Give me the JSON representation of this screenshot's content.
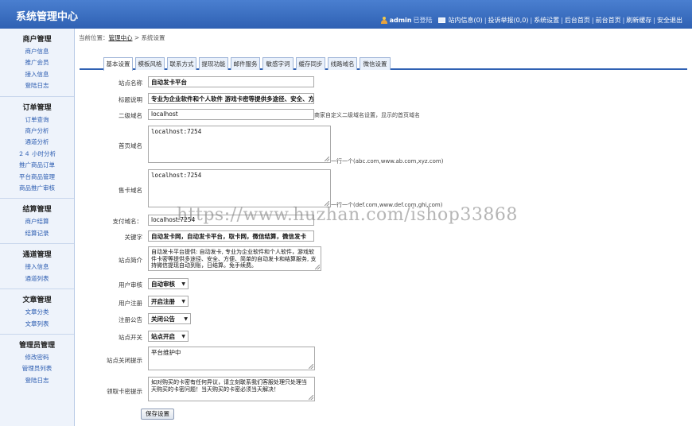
{
  "header": {
    "title": "系统管理中心",
    "user": "admin",
    "login_status": "已登陆",
    "messages": "站内信息(0)",
    "complaints": "投诉举报(0,0)",
    "nav": [
      "系统设置",
      "后台首页",
      "前台首页",
      "刷新缓存",
      "安全退出"
    ]
  },
  "sidebar": [
    {
      "title": "商户管理",
      "items": [
        "商户信息",
        "推广会员",
        "接入信息",
        "登陆日志"
      ]
    },
    {
      "title": "订单管理",
      "items": [
        "订单查询",
        "商户分析",
        "通道分析",
        "２４ 小时分析",
        "推广商品订单",
        "平台商品管理",
        "商品推广审核"
      ]
    },
    {
      "title": "结算管理",
      "items": [
        "商户结算",
        "结算记录"
      ]
    },
    {
      "title": "通道管理",
      "items": [
        "接入信息",
        "通道列表"
      ]
    },
    {
      "title": "文章管理",
      "items": [
        "文章分类",
        "文章列表"
      ]
    },
    {
      "title": "管理员管理",
      "items": [
        "修改密码",
        "管理员列表",
        "登陆日志"
      ]
    }
  ],
  "breadcrumb": {
    "prefix": "当前位置：",
    "link": "管理中心",
    "sep": " > ",
    "current": "系统设置"
  },
  "tabs": [
    "基本设置",
    "模板风格",
    "联系方式",
    "提现功能",
    "邮件服务",
    "敏感字词",
    "缓存同步",
    "线路域名",
    "微信设置"
  ],
  "form": {
    "site_name": {
      "label": "站点名称",
      "value": "自动发卡平台"
    },
    "title_desc": {
      "label": "标题说明",
      "value": "专业为企业软件和个人软件 游戏卡密等提供多途径、安全、方"
    },
    "second_domain": {
      "label": "二级域名",
      "value": "localhost",
      "hint": "商家自定义二级域名设置，显示的首页域名"
    },
    "home_domain": {
      "label": "首页域名",
      "value": "localhost:7254",
      "hint": "一行一个(abc.com,www.ab.com,xyz.com)"
    },
    "card_domain": {
      "label": "售卡域名",
      "value": "localhost:7254",
      "hint": "一行一个(def.com,www.def.com,ghi.com)"
    },
    "pay_domain": {
      "label": "支付域名：",
      "value": "localhost:7254"
    },
    "keywords": {
      "label": "关键字",
      "value": "自动发卡网，自动发卡平台，取卡网，微信结算，微信发卡"
    },
    "site_intro": {
      "label": "站点简介",
      "value": "自动发卡平台提供: 自动发卡, 专业为企业软件和个人软件，游戏软件卡密等提供多途径、安全、方便、简单的自动发卡和结算服务, 支持微信提现自动到账，日结算。免手续费。"
    },
    "user_review": {
      "label": "用户审核",
      "value": "自动审核"
    },
    "user_register": {
      "label": "用户注册",
      "value": "开启注册"
    },
    "register_notice": {
      "label": "注册公告",
      "value": "关闭公告"
    },
    "site_switch": {
      "label": "站点开关",
      "value": "站点开启"
    },
    "site_closed_tip": {
      "label": "站点关闭提示",
      "value": "平台维护中"
    },
    "card_tip": {
      "label": "领取卡密提示",
      "value": "如对购买的卡密有任何异议，请立刻联系我们客服处理只处理当天购买的卡密问题！当天购买的卡密必须当天解决！"
    },
    "save_label": "保存设置"
  },
  "watermark": "https://www.huzhan.com/ishop33868"
}
